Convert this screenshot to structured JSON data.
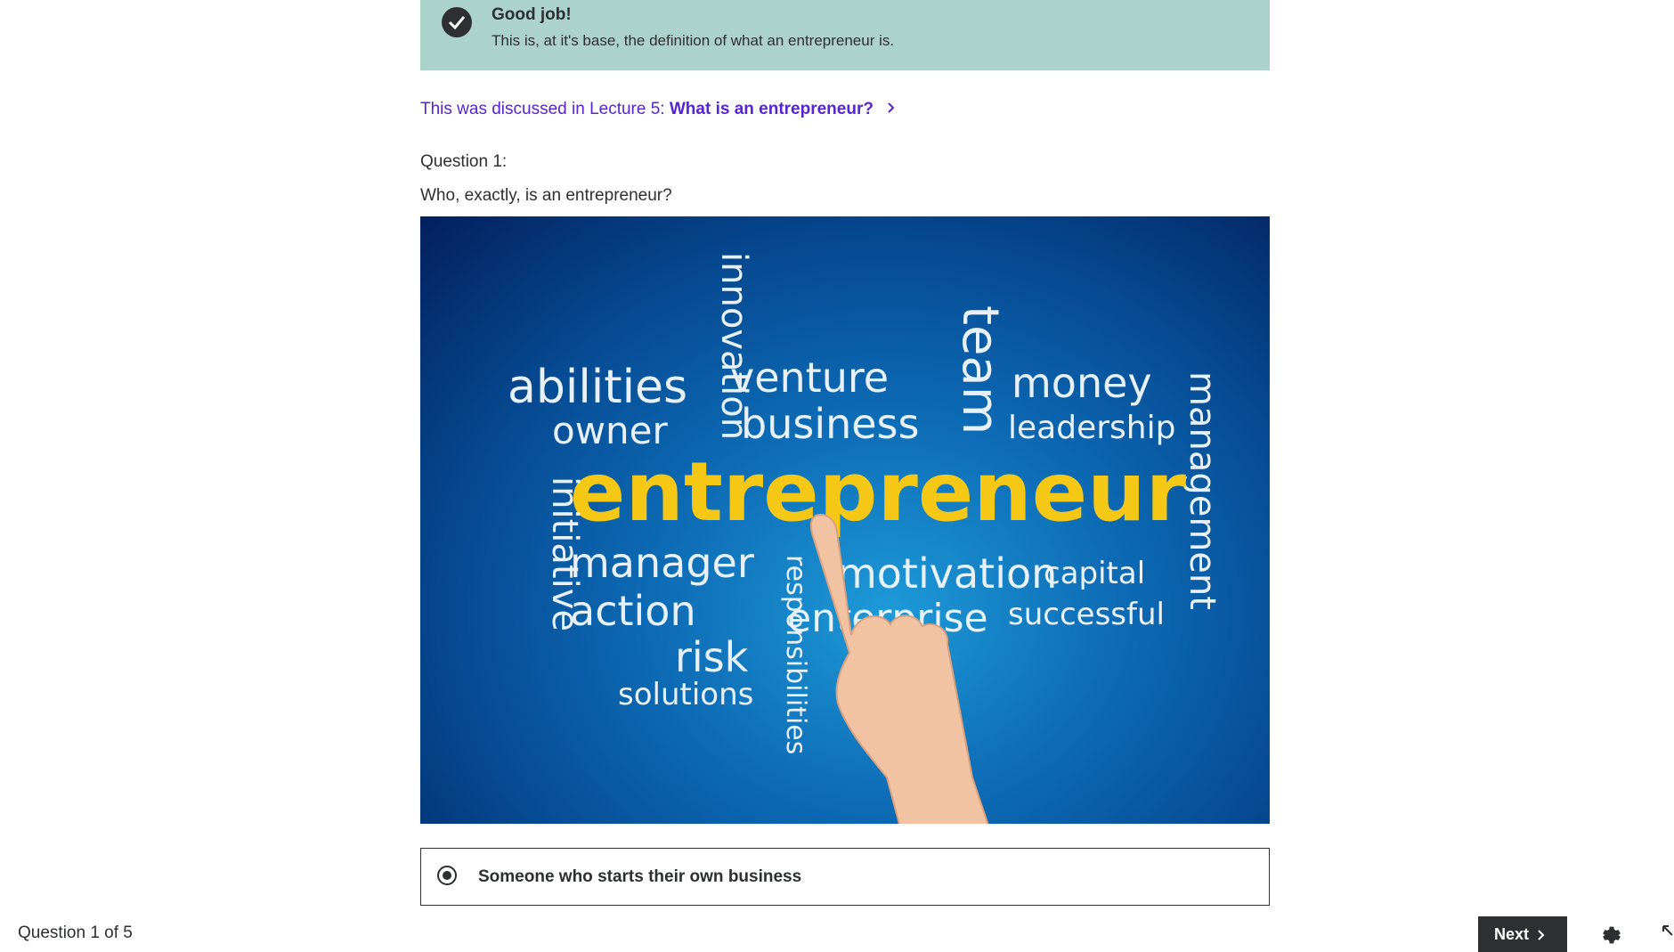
{
  "feedback": {
    "title": "Good job!",
    "description": "This is, at it's base, the definition of what an entrepreneur is."
  },
  "lecture_ref": {
    "prefix": "This was discussed in Lecture 5: ",
    "title": "What is an entrepreneur?"
  },
  "question": {
    "number_label": "Question 1:",
    "text": "Who, exactly, is an entrepreneur?"
  },
  "image_words": {
    "center": "entrepreneur",
    "abilities": "abilities",
    "owner": "owner",
    "innovation": "innovation",
    "venture": "venture",
    "business": "business",
    "team": "team",
    "money": "money",
    "leadership": "leadership",
    "management": "management",
    "initiative": "initiative",
    "manager": "manager",
    "action": "action",
    "risk": "risk",
    "solutions": "solutions",
    "responsibilities": "responsibilities",
    "motivation": "motivation",
    "capital": "capital",
    "enterprise": "enterprise",
    "successful": "successful"
  },
  "answer": {
    "label": "Someone who starts their own business",
    "selected": true
  },
  "footer": {
    "progress": "Question 1 of 5",
    "next_label": "Next"
  },
  "colors": {
    "banner": "#acd2cc",
    "link": "#5624d0",
    "dark": "#2d2f31",
    "highlight_word": "#f5c815"
  },
  "icons": [
    "check-circle-icon",
    "chevron-right-icon",
    "radio-selected-icon",
    "gear-icon",
    "expand-icon"
  ]
}
